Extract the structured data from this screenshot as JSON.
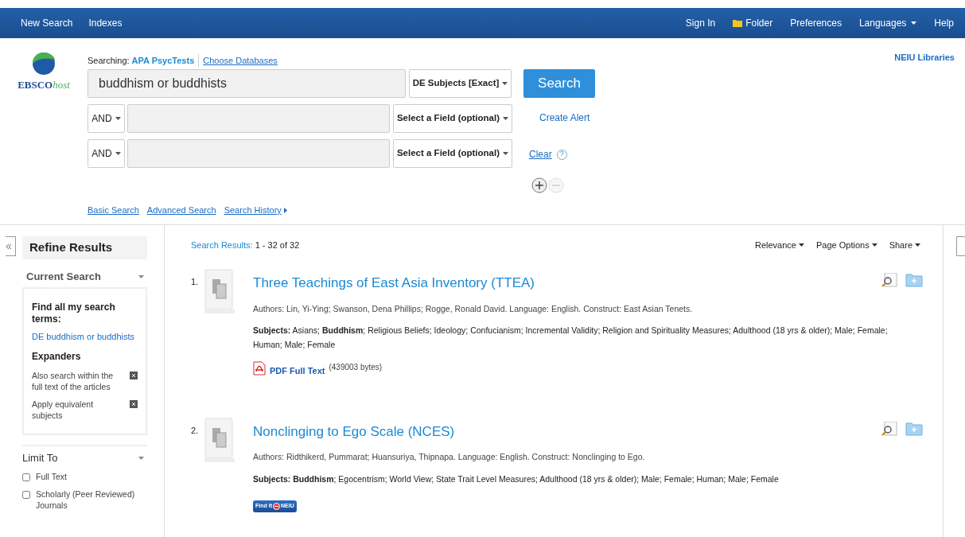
{
  "top_nav": {
    "left": [
      "New Search",
      "Indexes"
    ],
    "right": [
      {
        "label": "Sign In",
        "kind": "link"
      },
      {
        "label": "Folder",
        "kind": "folder"
      },
      {
        "label": "Preferences",
        "kind": "link"
      },
      {
        "label": "Languages",
        "kind": "dropdown"
      },
      {
        "label": "Help",
        "kind": "link"
      }
    ]
  },
  "logo": {
    "brand": "EBSCO",
    "suffix": "host"
  },
  "searching": {
    "label": "Searching:",
    "database": "APA PsycTests",
    "choose_link": "Choose Databases"
  },
  "institution": "NEIU Libraries",
  "search_rows": [
    {
      "operator": null,
      "value": "buddhism or buddhists",
      "field": "DE Subjects [Exact]"
    },
    {
      "operator": "AND",
      "value": null,
      "field": "Select a Field (optional)"
    },
    {
      "operator": "AND",
      "value": null,
      "field": "Select a Field (optional)"
    }
  ],
  "search_button": "Search",
  "create_alert": "Create Alert",
  "clear": "Clear",
  "help_mark": "?",
  "search_links": [
    {
      "label": "Basic Search",
      "arrow": false
    },
    {
      "label": "Advanced Search",
      "arrow": false
    },
    {
      "label": "Search History",
      "arrow": true
    }
  ],
  "sidebar": {
    "title": "Refine Results",
    "current_search": {
      "heading": "Current Search",
      "find_label": "Find all my search terms:",
      "term": "DE buddhism or buddhists",
      "expanders_heading": "Expanders",
      "expanders": [
        "Also search within the full text of the articles",
        "Apply equivalent subjects"
      ]
    },
    "limit_to": {
      "heading": "Limit To",
      "options": [
        {
          "label": "Full Text",
          "checked": false
        },
        {
          "label": "Scholarly (Peer Reviewed) Journals",
          "checked": false
        }
      ]
    }
  },
  "results": {
    "label": "Search Results:",
    "range": "1 - 32 of 32",
    "options": [
      "Relevance",
      "Page Options",
      "Share"
    ],
    "items": [
      {
        "number": "1.",
        "title": "Three Teachings of East Asia Inventory (TTEA)",
        "authors": "Authors: Lin, Yi-Ying; Swanson, Dena Phillips; Rogge, Ronald David. Language: English. Construct: East Asian Tenets.",
        "subjects": "**Subjects:** Asians; **Buddhism**; Religious Beliefs; Ideology; Confucianism; Incremental Validity; Religion and Spirituality Measures; Adulthood (18 yrs & older); Male; Female; Human; Male; Female",
        "link": {
          "kind": "pdf",
          "label": "PDF Full Text",
          "size": "(439003 bytes)"
        }
      },
      {
        "number": "2.",
        "title": "Nonclinging to Ego Scale (NCES)",
        "authors": "Authors: Ridthikerd, Pummarat; Huansuriya, Thipnapa. Language: English. Construct: Nonclinging to Ego.",
        "subjects": "**Subjects: Buddhism**; Egocentrism; World View; State Trait Level Measures; Adulthood (18 yrs & older); Male; Female; Human; Male; Female",
        "link": {
          "kind": "findit",
          "label": "Find It",
          "suffix": "NEIU"
        }
      }
    ]
  }
}
